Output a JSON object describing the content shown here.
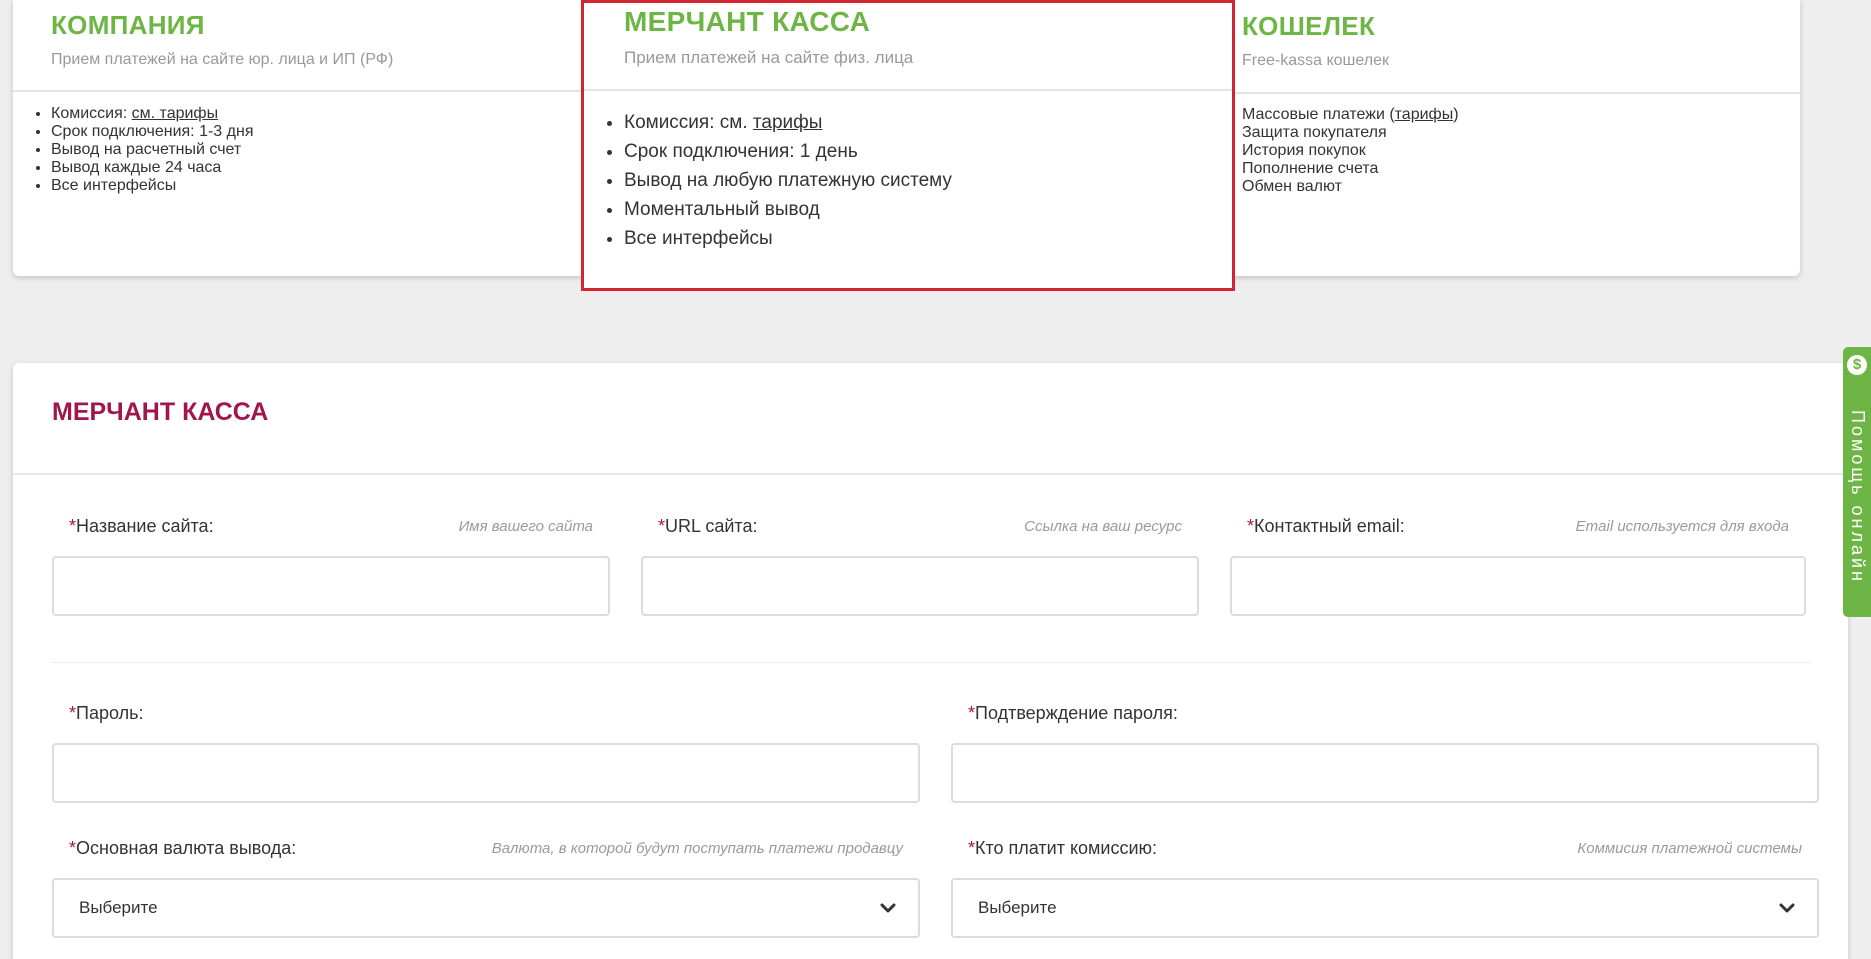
{
  "tariffs": {
    "company": {
      "title": "КОМПАНИЯ",
      "subtitle": "Прием платежей на сайте юр. лица и ИП (РФ)",
      "commission_prefix": "Комиссия: ",
      "commission_link": "см. тарифы",
      "items": [
        "Срок подключения: 1-3 дня",
        "Вывод на расчетный счет",
        "Вывод каждые 24 часа",
        "Все интерфейсы"
      ]
    },
    "merchant": {
      "title": "МЕРЧАНТ КАССА",
      "subtitle": "Прием платежей на сайте физ. лица",
      "commission_prefix": "Комиссия: см. ",
      "commission_link": "тарифы",
      "items": [
        "Срок подключения: 1 день",
        "Вывод на любую платежную систему",
        "Моментальный вывод",
        "Все интерфейсы"
      ]
    },
    "wallet": {
      "title": "КОШЕЛЕК",
      "subtitle": "Free-kassa кошелек",
      "mass_prefix": "Массовые платежи (",
      "mass_link": "тарифы",
      "mass_suffix": ")",
      "items": [
        "Защита покупателя",
        "История покупок",
        "Пополнение счета",
        "Обмен валют"
      ]
    }
  },
  "form": {
    "title": "МЕРЧАНТ КАССА",
    "required_mark": "*",
    "site_name": {
      "label": "Название сайта:",
      "hint": "Имя вашего сайта",
      "value": ""
    },
    "site_url": {
      "label": "URL сайта:",
      "hint": "Ссылка на ваш ресурс",
      "value": ""
    },
    "email": {
      "label": "Контактный email:",
      "hint": "Email используется для входа",
      "value": ""
    },
    "password": {
      "label": "Пароль:",
      "value": ""
    },
    "password_confirm": {
      "label": "Подтверждение пароля:",
      "value": ""
    },
    "currency": {
      "label": "Основная валюта вывода:",
      "hint": "Валюта, в которой будут поступать платежи продавцу",
      "selected": "Выберите"
    },
    "commission_payer": {
      "label": "Кто платит комиссию:",
      "hint": "Коммисия платежной системы",
      "selected": "Выберите"
    }
  },
  "help_widget": {
    "label": "Помощь онлайн",
    "icon": "dollar-icon",
    "icon_glyph": "$",
    "color": "#6db544"
  },
  "colors": {
    "green": "#6db544",
    "crimson": "#a0174d",
    "highlight_border": "#d32531"
  }
}
